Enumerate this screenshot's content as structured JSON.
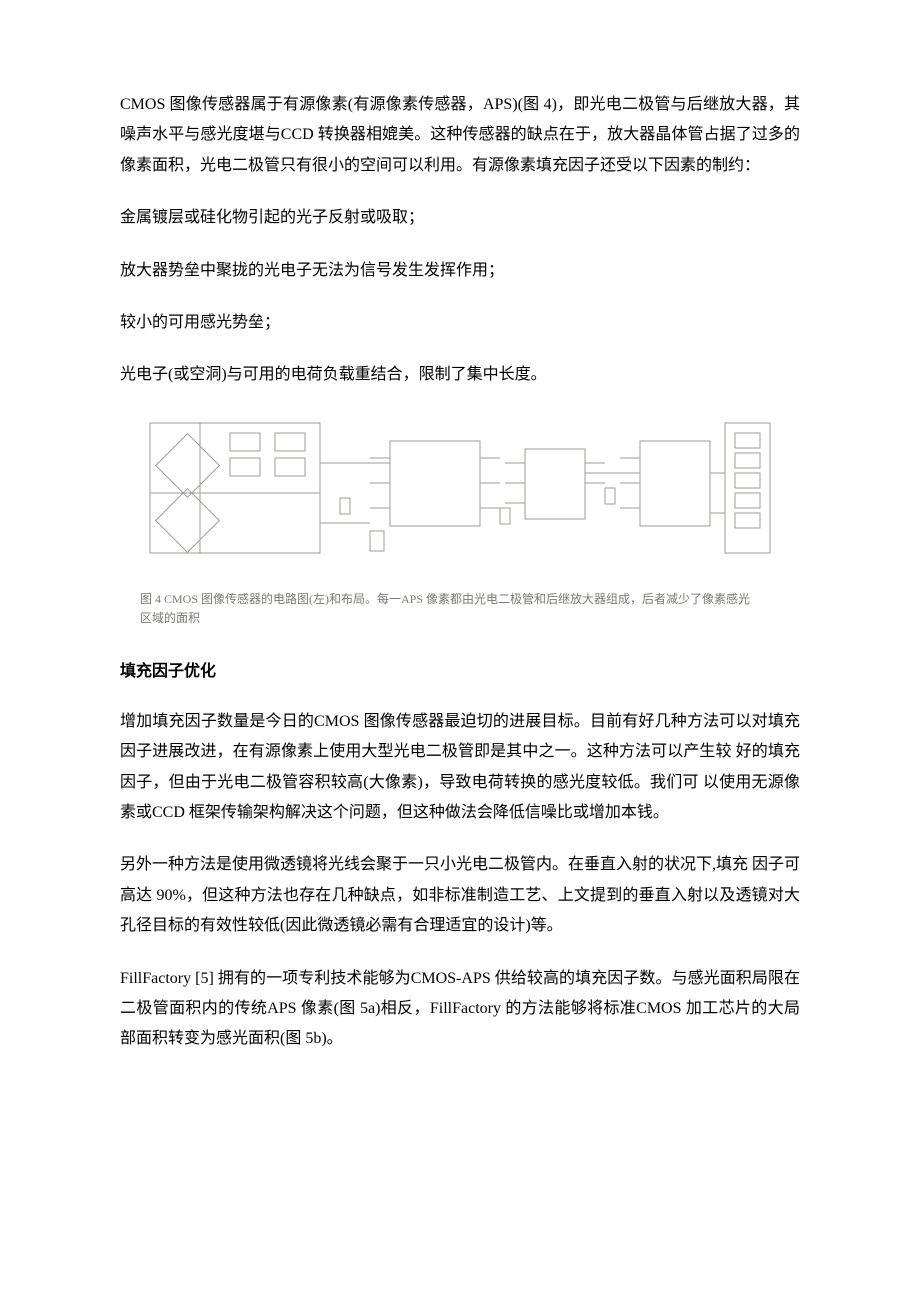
{
  "para1": "CMOS 图像传感器属于有源像素(有源像素传感器，APS)(图 4)，即光电二极管与后继放大器，其噪声水平与感光度堪与CCD 转换器相媲美。这种传感器的缺点在于，放大器晶体管占据了过多的像素面积，光电二极管只有很小的空间可以利用。有源像素填充因子还受以下因素的制约：",
  "bullet1": "金属镀层或硅化物引起的光子反射或吸取；",
  "bullet2": "放大器势垒中聚拢的光电子无法为信号发生发挥作用；",
  "bullet3": "较小的可用感光势垒；",
  "bullet4": "光电子(或空洞)与可用的电荷负载重结合，限制了集中长度。",
  "caption_line1": "图 4  CMOS 图像传感器的电路图(左)和布局。每一APS 像素都由光电二极管和后继放大器组成，后者减少了像素感光",
  "caption_line2": "区域的面积",
  "heading1": "填充因子优化",
  "para2": "增加填充因子数量是今日的CMOS 图像传感器最迫切的进展目标。目前有好几种方法可以对填充因子进展改进，在有源像素上使用大型光电二极管即是其中之一。这种方法可以产生较 好的填充因子，但由于光电二极管容积较高(大像素)，导致电荷转换的感光度较低。我们可 以使用无源像素或CCD 框架传输架构解决这个问题，但这种做法会降低信噪比或增加本钱。",
  "para3": "另外一种方法是使用微透镜将光线会聚于一只小光电二极管内。在垂直入射的状况下,填充 因子可高达 90%，但这种方法也存在几种缺点，如非标准制造工艺、上文提到的垂直入射以及透镜对大孔径目标的有效性较低(因此微透镜必需有合理适宜的设计)等。",
  "para4": "FillFactory [5] 拥有的一项专利技术能够为CMOS-APS 供给较高的填充因子数。与感光面积局限在二极管面积内的传统APS 像素(图 5a)相反，FillFactory 的方法能够将标准CMOS 加工芯片的大局部面积转变为感光面积(图 5b)。"
}
